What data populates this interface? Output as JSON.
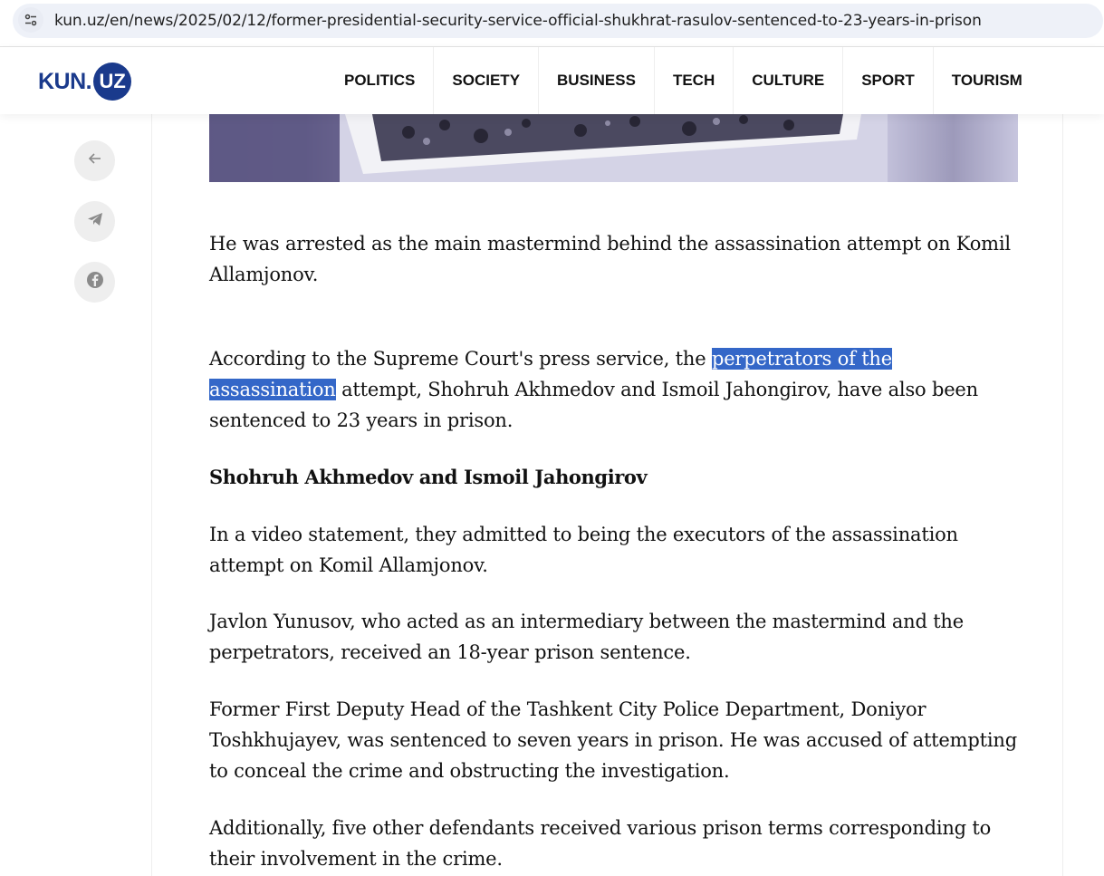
{
  "browser": {
    "url": "kun.uz/en/news/2025/02/12/former-presidential-security-service-official-shukhrat-rasulov-sentenced-to-23-years-in-prison"
  },
  "header": {
    "logo_text": "KUN.",
    "logo_badge": "UZ",
    "nav": [
      "POLITICS",
      "SOCIETY",
      "BUSINESS",
      "TECH",
      "CULTURE",
      "SPORT",
      "TOURISM"
    ]
  },
  "sidebar": {
    "icons": [
      "arrow-left-icon",
      "telegram-icon",
      "facebook-icon"
    ]
  },
  "article": {
    "p1": "He was arrested as the main mastermind behind the assassination attempt on Komil Allamjonov.",
    "p2_before": "According to the Supreme Court's press service, the ",
    "p2_highlight": "perpetrators of the assassination",
    "p2_after": " attempt, Shohruh Akhmedov and Ismoil Jahongirov, have also been sentenced to 23 years in prison.",
    "subheading": "Shohruh Akhmedov and Ismoil Jahongirov",
    "p3": "In a video statement, they admitted to being the executors of the assassination attempt on Komil Allamjonov.",
    "p4": "Javlon Yunusov, who acted as an intermediary between the mastermind and the perpetrators, received an 18-year prison sentence.",
    "p5": "Former First Deputy Head of the Tashkent City Police Department, Doniyor Toshkhujayev, was sentenced to seven years in prison. He was accused of attempting to conceal the crime and obstructing the investigation.",
    "p6": "Additionally, five other defendants received various prison terms corresponding to their involvement in the crime."
  },
  "colors": {
    "brand": "#1a3a8c",
    "selection": "#3467c8"
  }
}
